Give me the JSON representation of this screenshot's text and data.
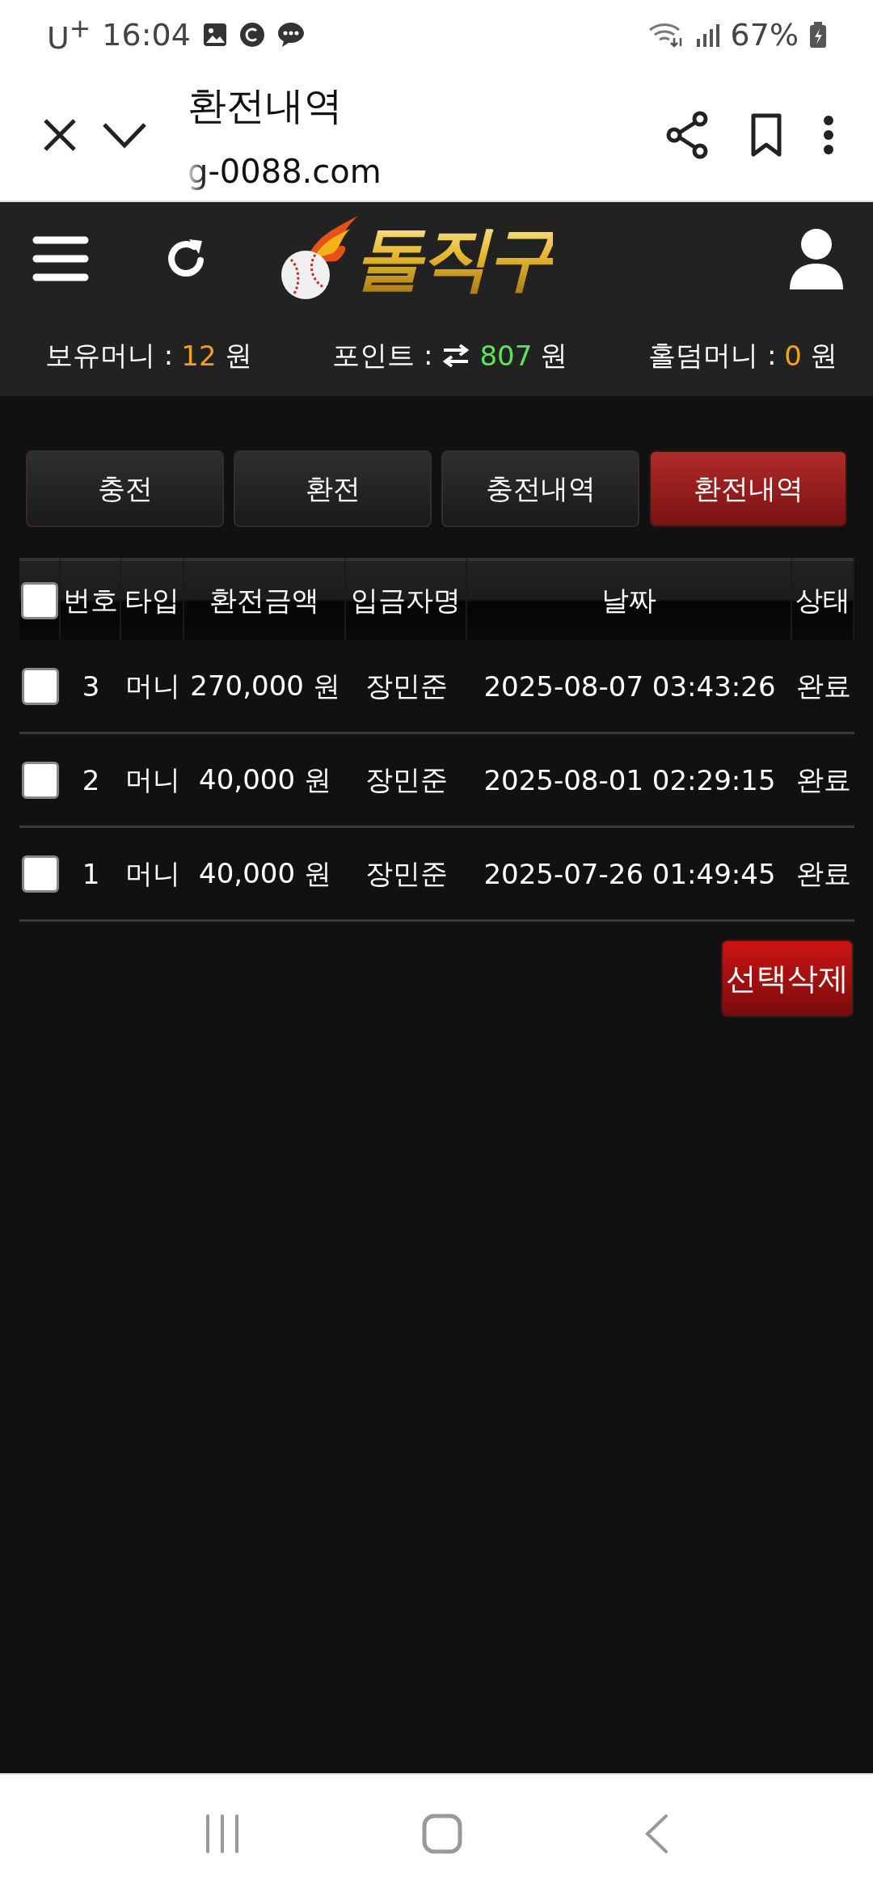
{
  "status_bar": {
    "carrier": "U$^{+}$",
    "time": "16:04",
    "battery": "67%"
  },
  "browser": {
    "title": "환전내역",
    "url": "g-0088.com"
  },
  "header": {
    "logo": "돌직구"
  },
  "balances": [
    {
      "kind": "plain",
      "label": "보유머니 :",
      "value": "12",
      "unit": "원",
      "color": "#f5a01a"
    },
    {
      "kind": "transfer",
      "label": "포인트 :",
      "value": "807",
      "unit": "원",
      "color": "#5de05a"
    },
    {
      "kind": "plain",
      "label": "홀덤머니 :",
      "value": "0",
      "unit": "원",
      "color": "#f5a01a"
    }
  ],
  "tabs": [
    {
      "label": "충전",
      "selected": false
    },
    {
      "label": "환전",
      "selected": false
    },
    {
      "label": "충전내역",
      "selected": false
    },
    {
      "label": "환전내역",
      "selected": true
    }
  ],
  "table": {
    "select_all": {
      "checked": false
    },
    "columns": [
      "번호",
      "타입",
      "환전금액",
      "입금자명",
      "날짜",
      "상태"
    ],
    "rows": [
      {
        "checked": false,
        "cells": [
          "3",
          "머니",
          "270,000 원",
          "장민준",
          "2025-08-07 03:43:26",
          "완료"
        ]
      },
      {
        "checked": false,
        "cells": [
          "2",
          "머니",
          "40,000 원",
          "장민준",
          "2025-08-01 02:29:15",
          "완료"
        ]
      },
      {
        "checked": false,
        "cells": [
          "1",
          "머니",
          "40,000 원",
          "장민준",
          "2025-07-26 01:49:45",
          "완료"
        ]
      }
    ]
  },
  "delete_button": "선택삭제"
}
